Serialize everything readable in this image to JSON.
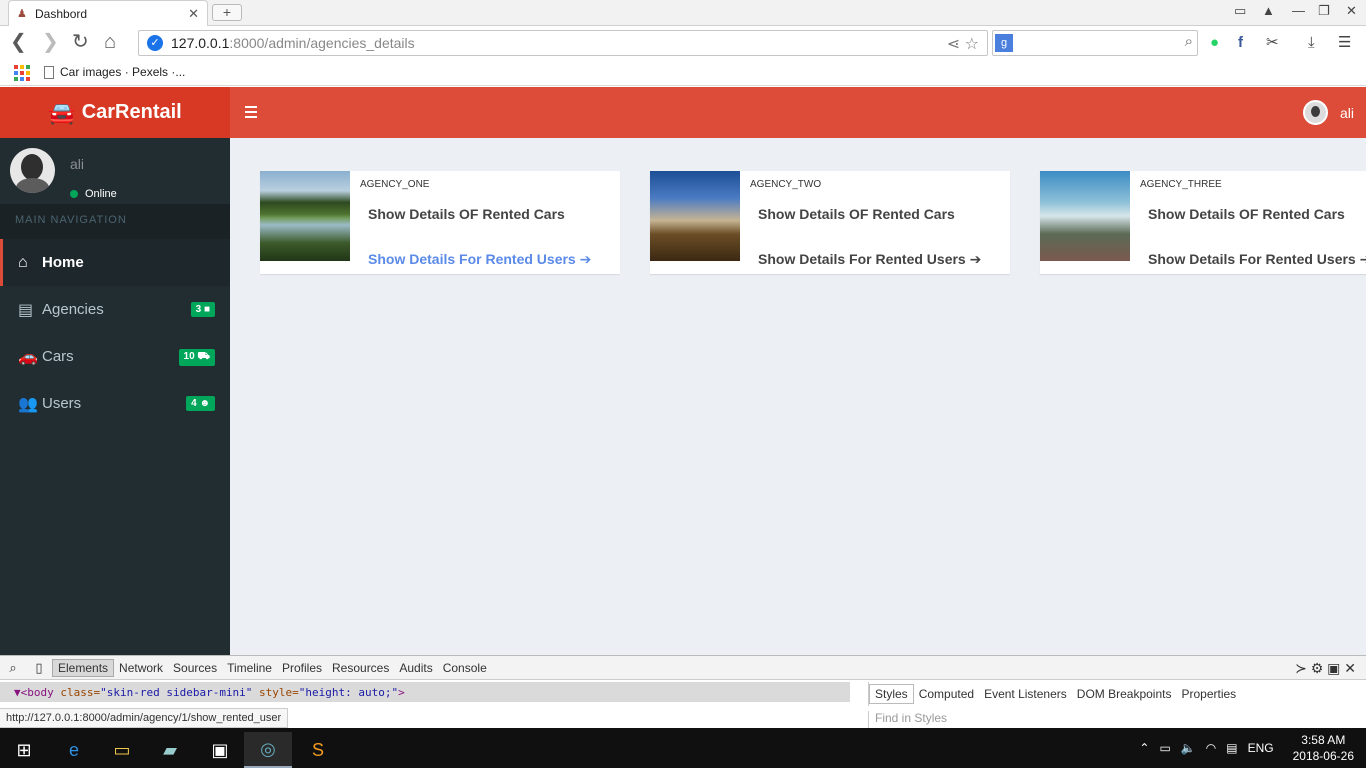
{
  "browser": {
    "tab_title": "Dashbord",
    "url_host": "127.0.0.1",
    "url_path": ":8000/admin/agencies_details",
    "bookmark_label": "Car images · Pexels ·...",
    "status_url": "http://127.0.0.1:8000/admin/agency/1/show_rented_user"
  },
  "app": {
    "brand": "CarRentail",
    "user_name": "ali",
    "status": "Online",
    "nav_header": "MAIN NAVIGATION",
    "accent": "#dd4b39",
    "sidebar_bg": "#222d32",
    "badge_color": "#00a65a",
    "menu": [
      {
        "label": "Home",
        "icon": "home-icon",
        "badge": ""
      },
      {
        "label": "Agencies",
        "icon": "archive-icon",
        "badge": "3"
      },
      {
        "label": "Cars",
        "icon": "car-icon",
        "badge": "10"
      },
      {
        "label": "Users",
        "icon": "users-icon",
        "badge": "4"
      }
    ],
    "agencies": [
      {
        "name": "AGENCY_ONE",
        "link1": "Show Details OF Rented Cars",
        "link2": "Show Details For Rented Users ➔"
      },
      {
        "name": "AGENCY_TWO",
        "link1": "Show Details OF Rented Cars",
        "link2": "Show Details For Rented Users ➔"
      },
      {
        "name": "AGENCY_THREE",
        "link1": "Show Details OF Rented Cars",
        "link2": "Show Details For Rented Users ➔"
      }
    ]
  },
  "devtools": {
    "tabs": [
      "Elements",
      "Network",
      "Sources",
      "Timeline",
      "Profiles",
      "Resources",
      "Audits",
      "Console"
    ],
    "code_tag_open": "▼<body",
    "code_attr1": " class=",
    "code_val1": "\"skin-red sidebar-mini\"",
    "code_attr2": " style=",
    "code_val2": "\"height: auto;\"",
    "code_tag_close": ">",
    "side_tabs": [
      "Styles",
      "Computed",
      "Event Listeners",
      "DOM Breakpoints",
      "Properties"
    ],
    "find_placeholder": "Find in Styles"
  },
  "taskbar": {
    "language": "ENG",
    "time": "3:58 AM",
    "date": "2018-06-26"
  }
}
